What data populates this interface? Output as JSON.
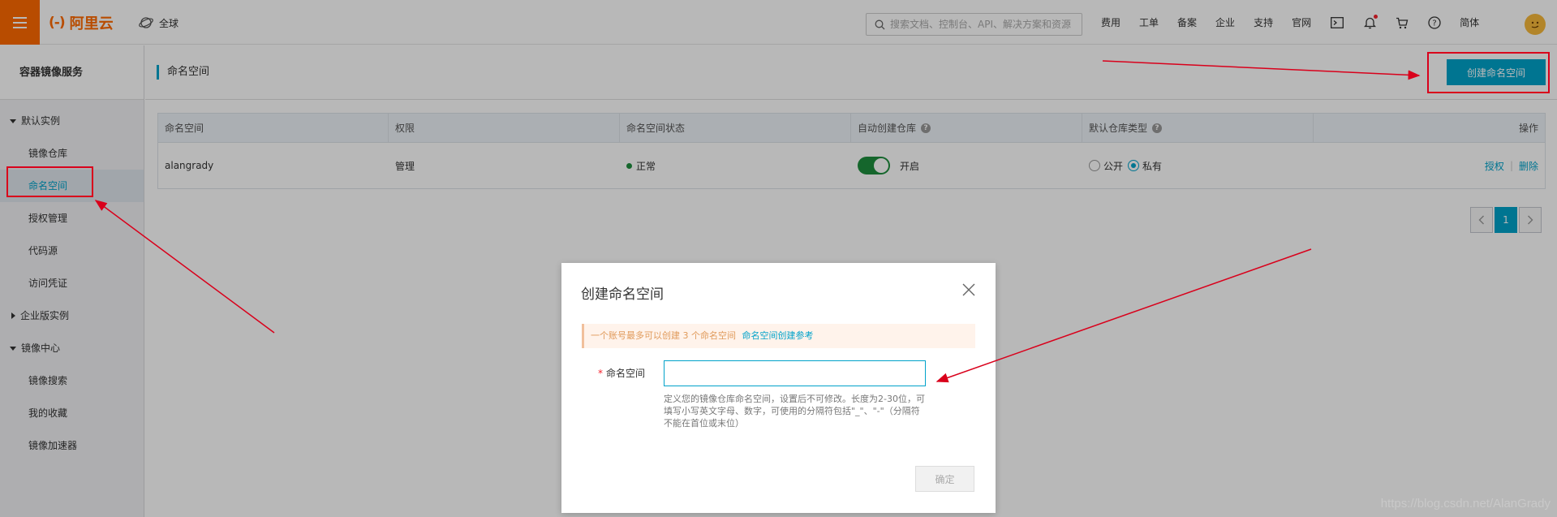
{
  "topbar": {
    "logo_mark": "(-)",
    "logo_text": "阿里云",
    "region": "全球",
    "search_placeholder": "搜索文档、控制台、API、解决方案和资源",
    "nav": [
      "费用",
      "工单",
      "备案",
      "企业",
      "支持",
      "官网"
    ],
    "lang": "简体",
    "icons": [
      "terminal-icon",
      "bell-icon",
      "cart-icon",
      "help-icon"
    ]
  },
  "sidebar": {
    "title": "容器镜像服务",
    "group1": "默认实例",
    "items1": [
      "镜像仓库",
      "命名空间",
      "授权管理",
      "代码源",
      "访问凭证"
    ],
    "group2": "企业版实例",
    "group3": "镜像中心",
    "items3": [
      "镜像搜索",
      "我的收藏",
      "镜像加速器"
    ]
  },
  "main": {
    "title": "命名空间",
    "create_button": "创建命名空间",
    "columns": [
      "命名空间",
      "权限",
      "命名空间状态",
      "自动创建仓库",
      "默认仓库类型",
      "操作"
    ],
    "row": {
      "name": "alangrady",
      "permission": "管理",
      "status": "正常",
      "auto_create": "开启",
      "repo_public": "公开",
      "repo_private": "私有",
      "op_auth": "授权",
      "op_delete": "删除"
    },
    "page": "1"
  },
  "dialog": {
    "title": "创建命名空间",
    "notice": "一个账号最多可以创建 3 个命名空间",
    "notice_link": "命名空间创建参考",
    "label": "命名空间",
    "input_value": "",
    "hint": "定义您的镜像仓库命名空间，设置后不可修改。长度为2-30位，可填写小写英文字母、数字，可使用的分隔符包括\"_\"、\"-\"（分隔符不能在首位或末位）",
    "ok_button": "确定"
  },
  "watermark": "https://blog.csdn.net/AlanGrady",
  "colors": {
    "accent": "#00a2ca",
    "brand": "#ff6a00",
    "annotation": "#d9001b"
  }
}
